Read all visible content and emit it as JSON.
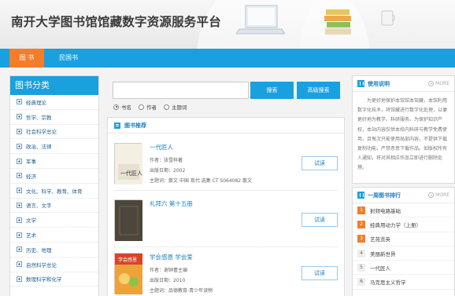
{
  "site": {
    "title": "南开大学图书馆馆藏数字资源服务平台"
  },
  "nav": {
    "items": [
      {
        "label": "图 书"
      },
      {
        "label": "民国书"
      }
    ]
  },
  "categories": {
    "title": "图书分类",
    "items": [
      {
        "label": "经典理论"
      },
      {
        "label": "哲学、宗教"
      },
      {
        "label": "社会科学总论"
      },
      {
        "label": "政治、法律"
      },
      {
        "label": "军事"
      },
      {
        "label": "经济"
      },
      {
        "label": "文化、科学、教育、体育"
      },
      {
        "label": "语言、文字"
      },
      {
        "label": "文学"
      },
      {
        "label": "艺术"
      },
      {
        "label": "历史、地理"
      },
      {
        "label": "自然科学总论"
      },
      {
        "label": "数理科学和化学"
      }
    ]
  },
  "search": {
    "placeholder": "",
    "search_button": "搜索",
    "advanced_button": "高级搜索",
    "options": [
      {
        "label": "书名",
        "checked": true
      },
      {
        "label": "作者",
        "checked": false
      },
      {
        "label": "主题词",
        "checked": false
      }
    ]
  },
  "recommend": {
    "title": "图书推荐",
    "read_label": "试读",
    "books": [
      {
        "title": "一代匠人",
        "author": "作者：张雪梓著",
        "date": "出版日期：2002",
        "subject": "主题词：散文 中国 现代 选集 CT S064082 散文",
        "cover_text": "一代匠人"
      },
      {
        "title": "礼拜六 第十五册",
        "author": "",
        "date": "",
        "subject": "",
        "cover_text": ""
      },
      {
        "title": "学会感恩 学会爱",
        "author": "作者：谢钟蕾主编",
        "date": "出版日期：2010",
        "subject": "主题词：品德教育-青少年读物",
        "cover_text": "学会感恩"
      }
    ]
  },
  "notice": {
    "title": "使用说明",
    "more": "MORE",
    "text": "为更好地保护本馆馆本馆藏，本馆利用数字化技术，将馆藏进行数字化处理，以便更好地为教学、科研服务。为保护知识产权，本站内容仅供本校内科研与教学免费使用，且每次只能使用局部内容，不提供下载复制功能，严禁恶意下载作品。如版权所有人通知，将对其相应作品立即进行删除处理。"
  },
  "ranking": {
    "title": "一周图书排行",
    "more": "MORE",
    "items": [
      {
        "rank": "1",
        "label": "射频电路基础"
      },
      {
        "rank": "2",
        "label": "经典用动力学（上册）"
      },
      {
        "rank": "3",
        "label": "艺苑览英"
      },
      {
        "rank": "4",
        "label": "美丽新世界"
      },
      {
        "rank": "5",
        "label": "一代匠人"
      },
      {
        "rank": "6",
        "label": "马克思主义哲学"
      }
    ]
  },
  "colors": {
    "primary": "#1aa0df",
    "accent": "#f37d2a",
    "link": "#1a7fc0"
  }
}
